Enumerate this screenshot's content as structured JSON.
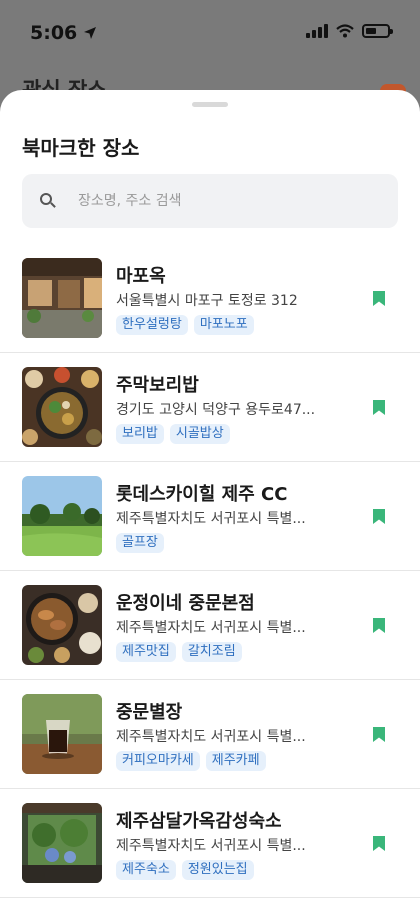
{
  "status": {
    "time": "5:06"
  },
  "background": {
    "title": "관심 장소"
  },
  "sheet": {
    "title": "북마크한 장소",
    "search": {
      "placeholder": "장소명, 주소 검색"
    }
  },
  "places": [
    {
      "name": "마포옥",
      "address": "서울특별시 마포구 토정로 312",
      "tags": [
        "한우설렁탕",
        "마포노포"
      ],
      "thumb": "restaurant-exterior"
    },
    {
      "name": "주막보리밥",
      "address": "경기도 고양시 덕양구 용두로47...",
      "tags": [
        "보리밥",
        "시골밥상"
      ],
      "thumb": "korean-meal"
    },
    {
      "name": "롯데스카이힐 제주 CC",
      "address": "제주특별자치도 서귀포시 특별...",
      "tags": [
        "골프장"
      ],
      "thumb": "golf-course"
    },
    {
      "name": "운정이네 중문본점",
      "address": "제주특별자치도 서귀포시 특별...",
      "tags": [
        "제주맛집",
        "갈치조림"
      ],
      "thumb": "braised-fish"
    },
    {
      "name": "중문별장",
      "address": "제주특별자치도 서귀포시 특별...",
      "tags": [
        "커피오마카세",
        "제주카페"
      ],
      "thumb": "coffee"
    },
    {
      "name": "제주삼달가옥감성숙소",
      "address": "제주특별자치도 서귀포시 특별...",
      "tags": [
        "제주숙소",
        "정원있는집"
      ],
      "thumb": "garden-view"
    }
  ],
  "colors": {
    "bookmark": "#3ab67a",
    "tag_text": "#2f6fbf",
    "tag_bg": "#e6f0fb"
  }
}
